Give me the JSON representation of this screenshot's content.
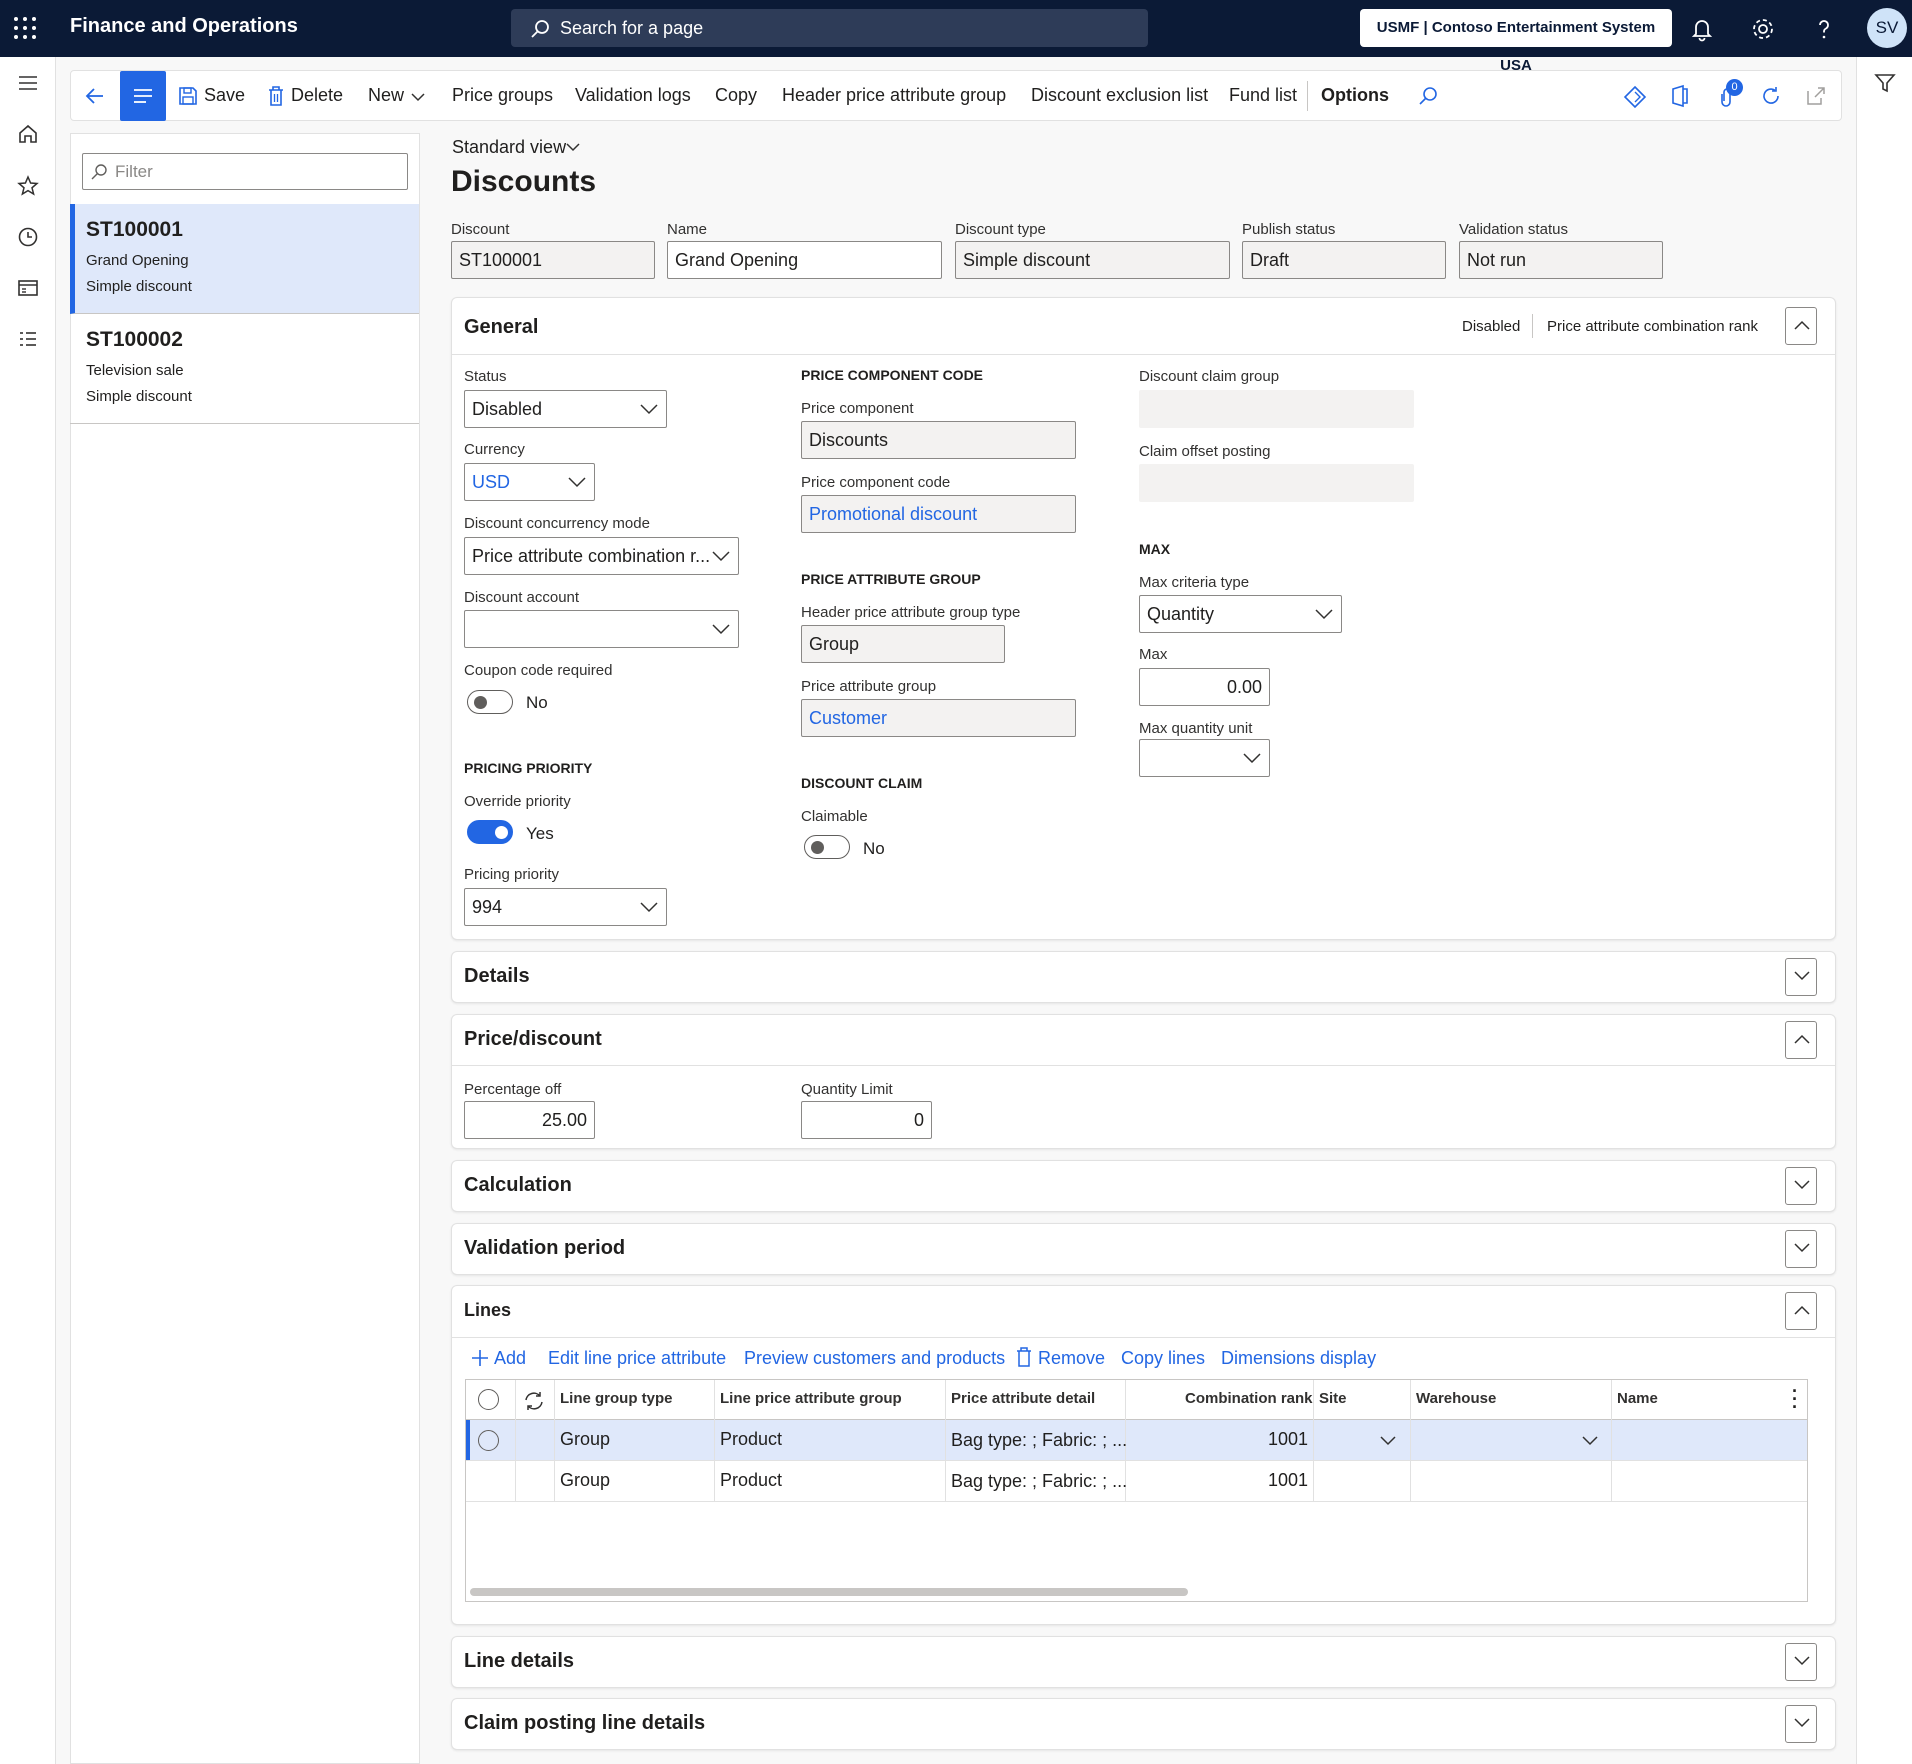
{
  "topbar": {
    "app_title": "Finance and Operations",
    "search_placeholder": "Search for a page",
    "company": "USMF | Contoso Entertainment System USA",
    "avatar_initials": "SV"
  },
  "actions": {
    "save": "Save",
    "delete": "Delete",
    "new": "New",
    "price_groups": "Price groups",
    "validation_logs": "Validation logs",
    "copy": "Copy",
    "header_price_attribute_group": "Header price attribute group",
    "discount_exclusion_list": "Discount exclusion list",
    "fund_list": "Fund list",
    "options": "Options",
    "notification_count": "0"
  },
  "list": {
    "filter_placeholder": "Filter",
    "items": [
      {
        "id": "ST100001",
        "name": "Grand Opening",
        "type": "Simple discount"
      },
      {
        "id": "ST100002",
        "name": "Television sale",
        "type": "Simple discount"
      }
    ]
  },
  "page": {
    "view": "Standard view",
    "title": "Discounts"
  },
  "header_fields": {
    "discount_label": "Discount",
    "discount_value": "ST100001",
    "name_label": "Name",
    "name_value": "Grand Opening",
    "type_label": "Discount type",
    "type_value": "Simple discount",
    "publish_label": "Publish status",
    "publish_value": "Draft",
    "validation_label": "Validation status",
    "validation_value": "Not run"
  },
  "general": {
    "title": "General",
    "summary1": "Disabled",
    "summary2": "Price attribute combination rank",
    "status_label": "Status",
    "status_value": "Disabled",
    "currency_label": "Currency",
    "currency_value": "USD",
    "concurrency_label": "Discount concurrency mode",
    "concurrency_value": "Price attribute combination r...",
    "account_label": "Discount account",
    "account_value": "",
    "coupon_label": "Coupon code required",
    "coupon_value": "No",
    "pricing_priority_header": "PRICING PRIORITY",
    "override_label": "Override priority",
    "override_value": "Yes",
    "priority_label": "Pricing priority",
    "priority_value": "994",
    "pcc_header": "PRICE COMPONENT CODE",
    "pc_label": "Price component",
    "pc_value": "Discounts",
    "pcc_label": "Price component code",
    "pcc_value": "Promotional discount",
    "pag_header": "PRICE ATTRIBUTE GROUP",
    "hpag_label": "Header price attribute group type",
    "hpag_value": "Group",
    "pag_label": "Price attribute group",
    "pag_value": "Customer",
    "claim_header": "DISCOUNT CLAIM",
    "claimable_label": "Claimable",
    "claimable_value": "No",
    "dcg_label": "Discount claim group",
    "cop_label": "Claim offset posting",
    "max_header": "MAX",
    "mct_label": "Max criteria type",
    "mct_value": "Quantity",
    "max_label": "Max",
    "max_value": "0.00",
    "mqu_label": "Max quantity unit",
    "mqu_value": ""
  },
  "details": {
    "title": "Details"
  },
  "price_discount": {
    "title": "Price/discount",
    "pct_label": "Percentage off",
    "pct_value": "25.00",
    "ql_label": "Quantity Limit",
    "ql_value": "0"
  },
  "calculation": {
    "title": "Calculation"
  },
  "validation_period": {
    "title": "Validation period"
  },
  "lines": {
    "title": "Lines",
    "toolbar": {
      "add": "Add",
      "edit": "Edit line price attribute",
      "preview": "Preview customers and products",
      "remove": "Remove",
      "copy_lines": "Copy lines",
      "dimensions": "Dimensions display"
    },
    "columns": [
      "Line group type",
      "Line price attribute group",
      "Price attribute detail",
      "Combination rank",
      "Site",
      "Warehouse",
      "Name"
    ],
    "rows": [
      {
        "group_type": "Group",
        "pag": "Product",
        "detail": "Bag type: ; Fabric: ; ...",
        "rank": "1001",
        "site": "",
        "warehouse": "",
        "name": ""
      },
      {
        "group_type": "Group",
        "pag": "Product",
        "detail": "Bag type: ; Fabric: ; ...",
        "rank": "1001",
        "site": "",
        "warehouse": "",
        "name": ""
      }
    ]
  },
  "line_details": {
    "title": "Line details"
  },
  "claim_posting": {
    "title": "Claim posting line details"
  },
  "colors": {
    "accent": "#2266e3",
    "topbar": "#0b1a36",
    "selected_row": "#dfe8fa"
  }
}
